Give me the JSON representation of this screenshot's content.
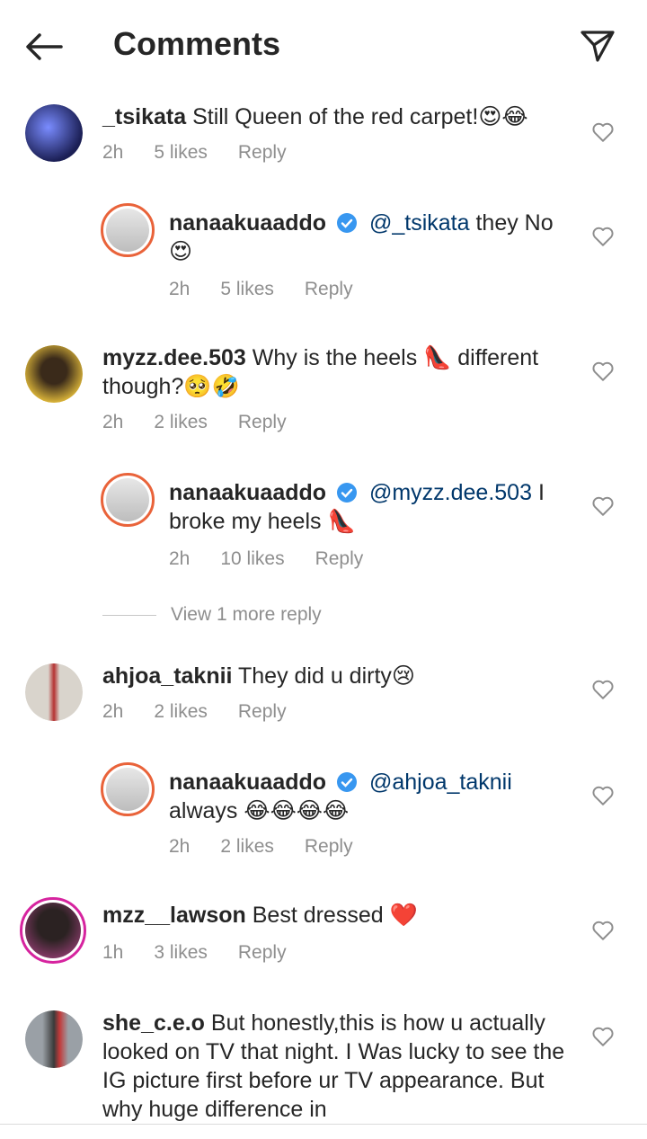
{
  "header": {
    "title": "Comments"
  },
  "comments": [
    {
      "username": "_tsikata",
      "text": "Still Queen of the red carpet!",
      "emoji": "😍😂",
      "time": "2h",
      "likes": "5 likes",
      "reply": "Reply",
      "avatar_color": "#3a3f8f"
    },
    {
      "username": "nanaakuaaddo",
      "mention": "@_tsikata",
      "text": "they No",
      "emoji": "😍",
      "time": "2h",
      "likes": "5 likes",
      "reply": "Reply",
      "avatar_color": "#d9d9d9"
    },
    {
      "username": "myzz.dee.503",
      "text": "Why is the heels",
      "emoji_mid": "👠",
      "text2": "different though?",
      "emoji": "🥺🤣",
      "time": "2h",
      "likes": "2 likes",
      "reply": "Reply",
      "avatar_color": "#c9a227"
    },
    {
      "username": "nanaakuaaddo",
      "mention": "@myzz.dee.503",
      "text": "I broke my heels",
      "emoji": "👠",
      "time": "2h",
      "likes": "10 likes",
      "reply": "Reply",
      "avatar_color": "#d9d9d9"
    },
    {
      "username": "ahjoa_taknii",
      "text": "They did u dirty",
      "emoji": "😢",
      "time": "2h",
      "likes": "2 likes",
      "reply": "Reply",
      "avatar_color": "#b33a3a"
    },
    {
      "username": "nanaakuaaddo",
      "mention": "@ahjoa_taknii",
      "text": "always",
      "emoji": "😂😂😂😂",
      "time": "2h",
      "likes": "2 likes",
      "reply": "Reply",
      "avatar_color": "#d9d9d9"
    },
    {
      "username": "mzz__lawson",
      "text": "Best dressed",
      "emoji": "❤️",
      "time": "1h",
      "likes": "3 likes",
      "reply": "Reply",
      "avatar_color": "#8a3b6b"
    },
    {
      "username": "she_c.e.o",
      "text": "But honestly,this is how u actually looked on TV that night.  I Was lucky to see the IG picture first before ur TV appearance. But why huge difference in",
      "avatar_color": "#6b6b6b"
    }
  ],
  "view_more": "View 1 more reply",
  "icons": {
    "back": "arrow-left-icon",
    "send": "send-paper-plane-icon",
    "like": "heart-outline-icon",
    "verified": "verified-badge-icon"
  },
  "colors": {
    "mention": "#00376b",
    "verified": "#3897f0",
    "muted": "#8e8e8e"
  }
}
